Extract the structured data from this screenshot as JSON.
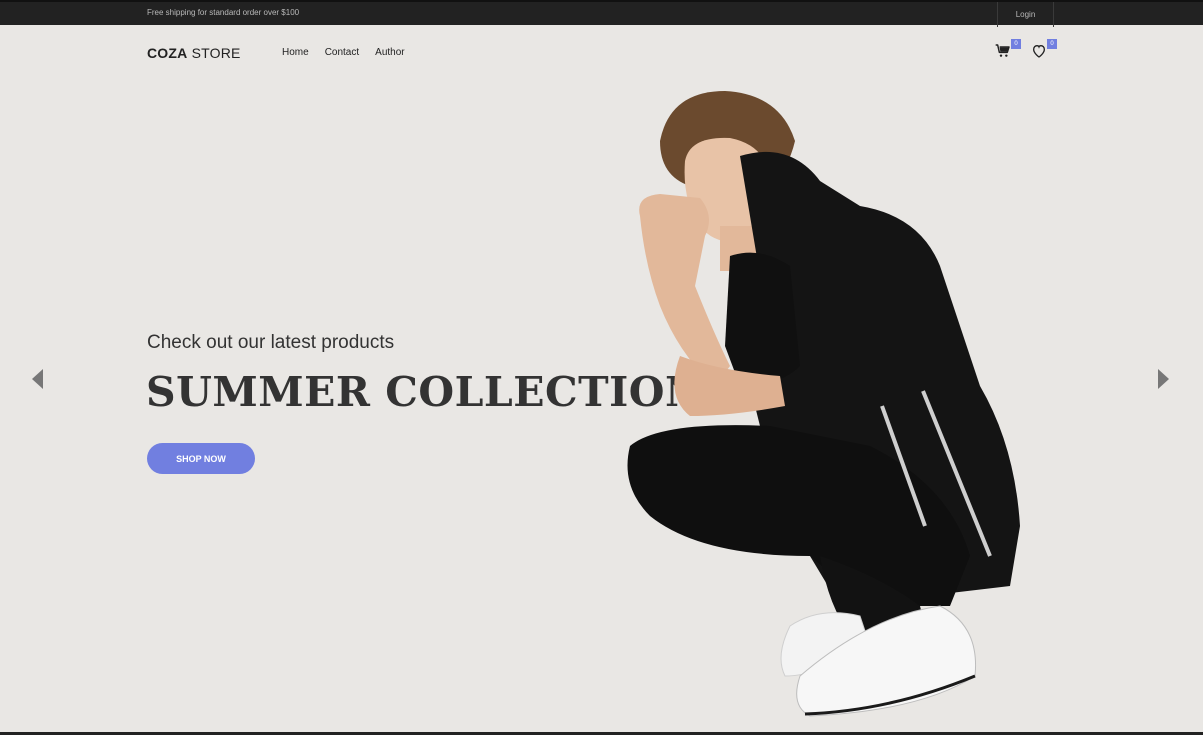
{
  "topbar": {
    "shipping_text": "Free shipping for standard order over $100",
    "login_label": "Login"
  },
  "header": {
    "logo_bold": "COZA",
    "logo_light": "STORE",
    "nav": [
      {
        "label": "Home"
      },
      {
        "label": "Contact"
      },
      {
        "label": "Author"
      }
    ],
    "cart_count": "0",
    "wishlist_count": "0"
  },
  "hero": {
    "subtitle": "Check out our latest products",
    "headline": "SUMMER COLLECTION",
    "cta_label": "SHOP NOW"
  },
  "colors": {
    "background": "#e9e7e4",
    "topbar": "#222222",
    "accent": "#717fe0",
    "text": "#333333"
  },
  "icons": {
    "cart": "cart-icon",
    "wishlist": "heart-icon",
    "prev": "chevron-left-icon",
    "next": "chevron-right-icon"
  }
}
